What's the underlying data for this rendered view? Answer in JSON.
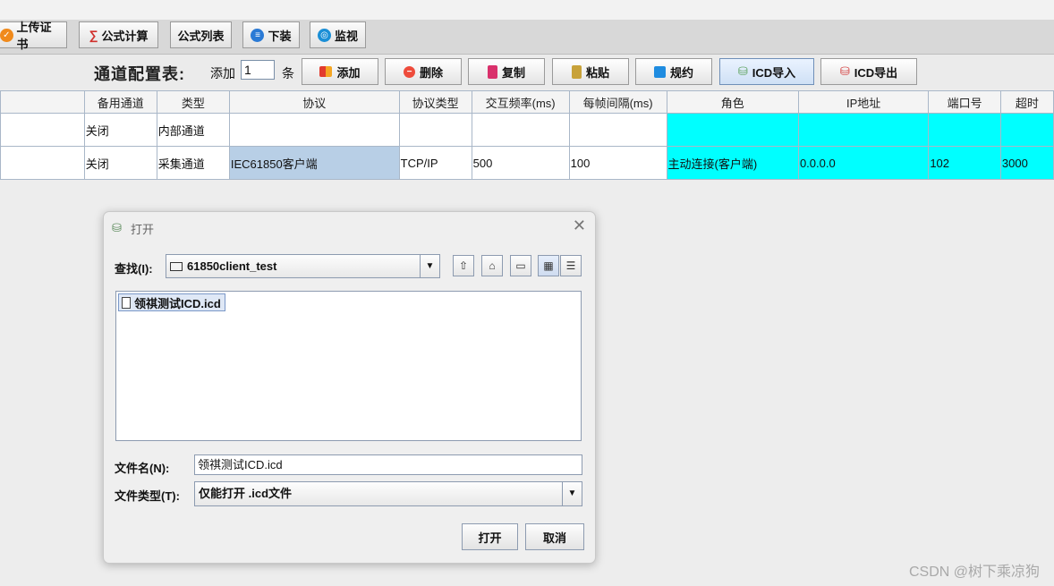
{
  "toolbar1": {
    "upload_cert": "上传证书",
    "formula_calc": "公式计算",
    "formula_list": "公式列表",
    "download": "下装",
    "monitor": "监视"
  },
  "toolbar2": {
    "title": "通道配置表:",
    "add_prefix": "添加",
    "count": "1",
    "unit": "条",
    "add": "添加",
    "delete": "删除",
    "copy": "复制",
    "paste": "粘贴",
    "protocol": "规约",
    "icd_import": "ICD导入",
    "icd_export": "ICD导出"
  },
  "table": {
    "headers": [
      "备用通道",
      "类型",
      "协议",
      "协议类型",
      "交互频率(ms)",
      "每帧间隔(ms)",
      "角色",
      "IP地址",
      "端口号",
      "超时"
    ],
    "rows": [
      [
        "关闭",
        "内部通道",
        "",
        "",
        "",
        "",
        "",
        "",
        "",
        ""
      ],
      [
        "关闭",
        "采集通道",
        "IEC61850客户端",
        "TCP/IP",
        "500",
        "100",
        "主动连接(客户端)",
        "0.0.0.0",
        "102",
        "3000"
      ]
    ]
  },
  "dialog": {
    "title": "打开",
    "lookin_label": "查找(I):",
    "folder": "61850client_test",
    "files": [
      "领祺测试ICD.icd"
    ],
    "filename_label": "文件名(N):",
    "filename_value": "领祺测试ICD.icd",
    "filetype_label": "文件类型(T):",
    "filetype_value": "仅能打开 .icd文件",
    "open_button": "打开",
    "cancel_button": "取消"
  },
  "watermark": "CSDN @树下乘凉狗",
  "colors": {
    "accent_cyan": "#00ffff",
    "selected_cell": "#b8cfe6"
  }
}
